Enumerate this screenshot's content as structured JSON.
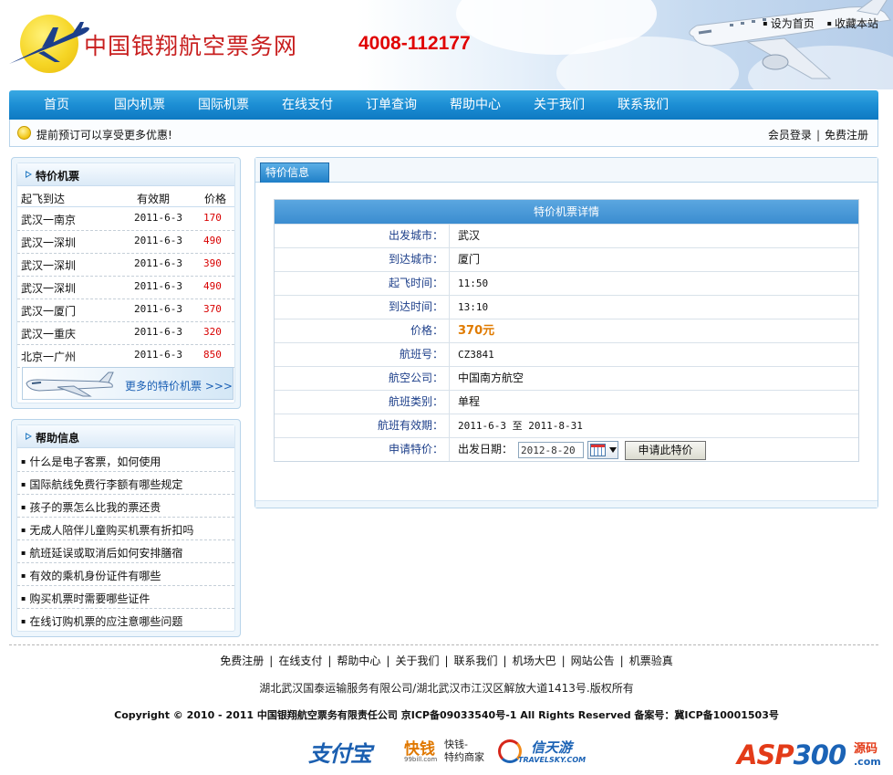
{
  "header": {
    "site_title": "中国银翔航空票务网",
    "hotline": "4008-112177",
    "top_links": [
      "设为首页",
      "收藏本站"
    ]
  },
  "nav": {
    "items": [
      "首页",
      "国内机票",
      "国际机票",
      "在线支付",
      "订单查询",
      "帮助中心",
      "关于我们",
      "联系我们"
    ]
  },
  "notice": {
    "text": "提前预订可以享受更多优惠!",
    "member_login": "会员登录",
    "separator": "|",
    "register": "免费注册"
  },
  "special_fares": {
    "title": "特价机票",
    "columns": [
      "起飞到达",
      "有效期",
      "价格"
    ],
    "rows": [
      {
        "route": "武汉一南京",
        "date": "2011-6-3",
        "price": "170"
      },
      {
        "route": "武汉一深圳",
        "date": "2011-6-3",
        "price": "490"
      },
      {
        "route": "武汉一深圳",
        "date": "2011-6-3",
        "price": "390"
      },
      {
        "route": "武汉一深圳",
        "date": "2011-6-3",
        "price": "490"
      },
      {
        "route": "武汉一厦门",
        "date": "2011-6-3",
        "price": "370"
      },
      {
        "route": "武汉一重庆",
        "date": "2011-6-3",
        "price": "320"
      },
      {
        "route": "北京一广州",
        "date": "2011-6-3",
        "price": "850"
      }
    ],
    "more_link": "更多的特价机票 >>>"
  },
  "help_info": {
    "title": "帮助信息",
    "items": [
      "什么是电子客票，如何使用",
      "国际航线免费行李额有哪些规定",
      "孩子的票怎么比我的票还贵",
      "无成人陪伴儿童购买机票有折扣吗",
      "航班延误或取消后如何安排膳宿",
      "有效的乘机身份证件有哪些",
      "购买机票时需要哪些证件",
      "在线订购机票的应注意哪些问题"
    ]
  },
  "main": {
    "tab": "特价信息",
    "detail_title": "特价机票详情",
    "fields": {
      "depart_city": {
        "label": "出发城市：",
        "value": "武汉"
      },
      "arrive_city": {
        "label": "到达城市：",
        "value": "厦门"
      },
      "depart_time": {
        "label": "起飞时间：",
        "value": "11:50"
      },
      "arrive_time": {
        "label": "到达时间：",
        "value": "13:10"
      },
      "price": {
        "label": "价格：",
        "value": "370元"
      },
      "flight_no": {
        "label": "航班号：",
        "value": "CZ3841"
      },
      "airline": {
        "label": "航空公司：",
        "value": "中国南方航空"
      },
      "flight_type": {
        "label": "航班类别：",
        "value": "单程"
      },
      "validity": {
        "label": "航班有效期：",
        "value": "2011-6-3 至 2011-8-31"
      },
      "apply": {
        "label": "申请特价：",
        "date_label": "出发日期：",
        "date_value": "2012-8-20",
        "button": "申请此特价"
      }
    }
  },
  "footer": {
    "links": [
      "免费注册",
      "在线支付",
      "帮助中心",
      "关于我们",
      "联系我们",
      "机场大巴",
      "网站公告",
      "机票验真"
    ],
    "address": "湖北武汉国泰运输服务有限公司/湖北武汉市江汉区解放大道1413号.版权所有",
    "copyright": "Copyright © 2010 - 2011 中国银翔航空票务有限责任公司  京ICP备09033540号-1 All Rights Reserved 备案号：冀ICP备10001503号",
    "partners": {
      "alipay": "支付宝",
      "kuaiqian_main": "快钱",
      "kuaiqian_url": "99bill.com",
      "kuaiqian_side_1": "快钱-",
      "kuaiqian_side_2": "特约商家",
      "travelsky_cn": "信天游",
      "travelsky_en": "TRAVELSKY.COM",
      "asp_brand_1": "ASP",
      "asp_brand_2": "300",
      "asp_cn": "源码",
      "asp_com": ".com"
    }
  },
  "colors": {
    "nav_blue": "#1c8ed4",
    "title_red": "#c81e1e",
    "hotline_red": "#e00000",
    "price_red": "#d80000",
    "price_orange": "#e07b00",
    "label_blue": "#1d3f8a"
  },
  "icons": [
    "logo-plane-icon",
    "big-airplane-icon",
    "smile-icon",
    "triangle-bullet-icon",
    "calendar-icon",
    "dropdown-arrow-icon",
    "banner-plane-icon"
  ]
}
